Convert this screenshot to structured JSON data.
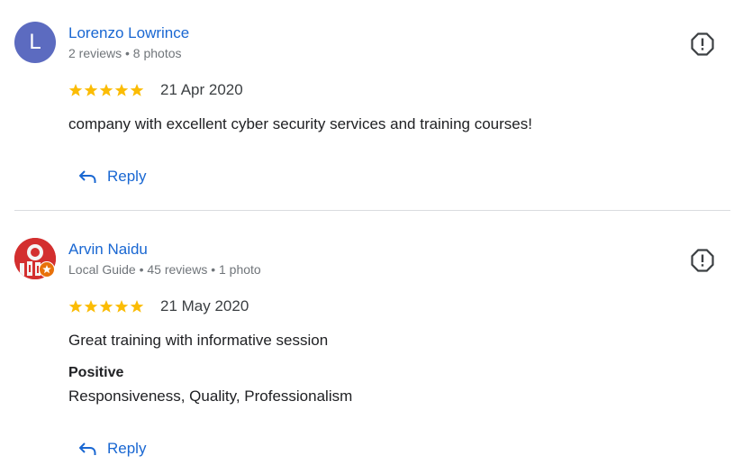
{
  "colors": {
    "link": "#1967d2",
    "star": "#fbbc04",
    "avatar_1": "#5c6bc0",
    "avatar_2": "#d32f2f",
    "guide_badge": "#e8710a"
  },
  "reviews": [
    {
      "avatar_letter": "L",
      "author": "Lorenzo Lowrince",
      "meta": "2 reviews • 8 photos",
      "rating": 5,
      "date": "21 Apr 2020",
      "text": "company with excellent cyber security services and training courses!",
      "reply_label": "Reply",
      "flag_icon": "report-icon",
      "reply_icon": "reply-arrow-icon"
    },
    {
      "author": "Arvin Naidu",
      "meta": "Local Guide • 45 reviews • 1 photo",
      "rating": 5,
      "date": "21 May 2020",
      "text": "Great training with informative session",
      "attributes_heading": "Positive",
      "attributes_values": "Responsiveness, Quality, Professionalism",
      "reply_label": "Reply",
      "flag_icon": "report-icon",
      "reply_icon": "reply-arrow-icon"
    }
  ]
}
